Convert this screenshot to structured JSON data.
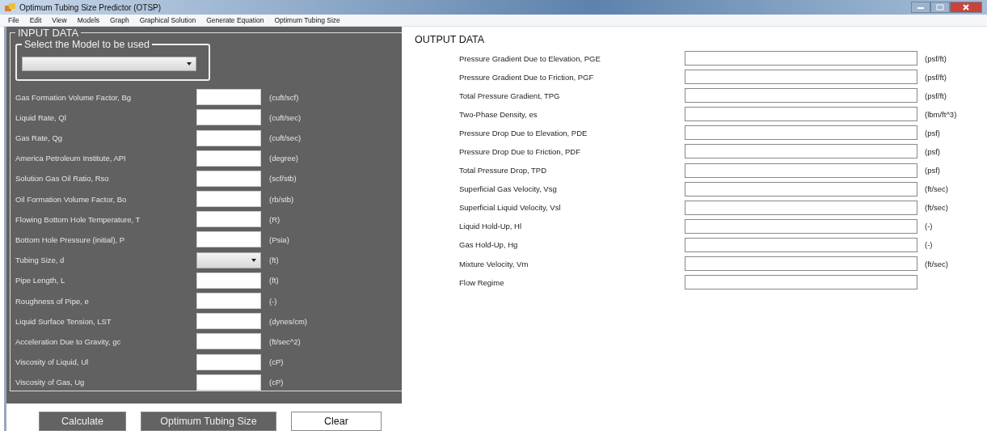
{
  "window": {
    "title": "Optimum Tubing Size Predictor (OTSP)"
  },
  "menu": [
    "File",
    "Edit",
    "View",
    "Models",
    "Graph",
    "Graphical Solution",
    "Generate Equation",
    "Optimum Tubing Size"
  ],
  "input_panel": {
    "title": "INPUT DATA",
    "model_group": {
      "title": "Select the Model to be used"
    },
    "rows": [
      {
        "label": "Gas Formation Volume Factor, Bg",
        "kind": "text",
        "unit": "(cuft/scf)"
      },
      {
        "label": "Liquid Rate, Ql",
        "kind": "text",
        "unit": "(cuft/sec)"
      },
      {
        "label": "Gas Rate, Qg",
        "kind": "text",
        "unit": "(cuft/sec)"
      },
      {
        "label": "America Petroleum Institute, API",
        "kind": "text",
        "unit": "(degree)"
      },
      {
        "label": "Solution Gas Oil Ratio, Rso",
        "kind": "text",
        "unit": "(scf/stb)"
      },
      {
        "label": "Oil Formation Volume Factor, Bo",
        "kind": "text",
        "unit": "(rb/stb)"
      },
      {
        "label": "Flowing Bottom Hole Temperature, T",
        "kind": "text",
        "unit": "(R)"
      },
      {
        "label": "Bottom Hole Pressure (initial), P",
        "kind": "text",
        "unit": "(Psia)"
      },
      {
        "label": "Tubing Size, d",
        "kind": "dropdown",
        "unit": "(ft)"
      },
      {
        "label": "Pipe Length, L",
        "kind": "text",
        "unit": "(ft)"
      },
      {
        "label": "Roughness of Pipe, e",
        "kind": "text",
        "unit": "(-)"
      },
      {
        "label": "Liquid Surface Tension, LST",
        "kind": "text",
        "unit": "(dynes/cm)"
      },
      {
        "label": "Acceleration Due to Gravity, gc",
        "kind": "text",
        "unit": "(ft/sec^2)"
      },
      {
        "label": "Viscosity of Liquid, Ul",
        "kind": "text",
        "unit": "(cP)"
      },
      {
        "label": "Viscosity of Gas, Ug",
        "kind": "text",
        "unit": "(cP)"
      }
    ],
    "buttons": [
      {
        "label": "Calculate",
        "kind": "dark"
      },
      {
        "label": "Optimum Tubing Size",
        "kind": "dark"
      },
      {
        "label": "Clear",
        "kind": "light"
      }
    ]
  },
  "output_panel": {
    "title": "OUTPUT DATA",
    "rows": [
      {
        "label": "Pressure Gradient Due to Elevation, PGE",
        "unit": "(psf/ft)"
      },
      {
        "label": "Pressure Gradient Due to Friction, PGF",
        "unit": "(psf/ft)"
      },
      {
        "label": "Total Pressure Gradient, TPG",
        "unit": "(psf/ft)"
      },
      {
        "label": "Two-Phase Density, es",
        "unit": "(lbm/ft^3)"
      },
      {
        "label": "Pressure Drop Due to Elevation, PDE",
        "unit": "(psf)"
      },
      {
        "label": "Pressure Drop Due to Friction, PDF",
        "unit": "(psf)"
      },
      {
        "label": "Total Pressure Drop, TPD",
        "unit": "(psf)"
      },
      {
        "label": "Superficial Gas Velocity, Vsg",
        "unit": "(ft/sec)"
      },
      {
        "label": "Superficial Liquid Velocity, Vsl",
        "unit": "(ft/sec)"
      },
      {
        "label": "Liquid Hold-Up, Hl",
        "unit": "(-)"
      },
      {
        "label": "Gas Hold-Up, Hg",
        "unit": "(-)"
      },
      {
        "label": "Mixture Velocity, Vm",
        "unit": "(ft/sec)"
      },
      {
        "label": "Flow Regime"
      }
    ]
  }
}
